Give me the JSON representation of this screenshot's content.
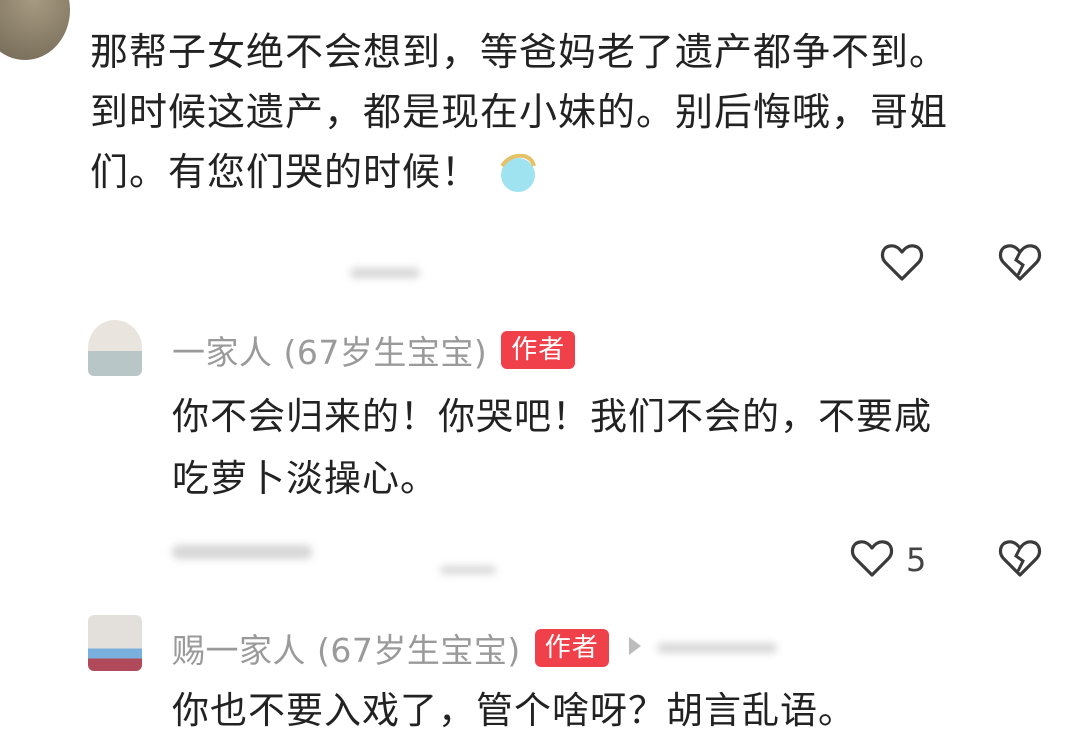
{
  "comment_top": {
    "text_lines": [
      "那帮子女绝不会想到，等爸妈老了遗产都争不到。",
      "到时候这遗产，都是现在小妹的。别后悔哦，哥姐",
      "们。有您们哭的时候！"
    ]
  },
  "reply_1": {
    "author": "一家人 (67岁生宝宝)",
    "badge": "作者",
    "text_lines": [
      "你不会归来的！你哭吧！我们不会的，不要咸",
      "吃萝卜淡操心。"
    ],
    "like_count": "5"
  },
  "reply_2": {
    "author": "赐一家人 (67岁生宝宝)",
    "badge": "作者",
    "text": "你也不要入戏了，管个啥呀？胡言乱语。"
  },
  "icons": [
    "heart-outline-icon",
    "heart-broken-icon",
    "emoji-icon",
    "reply-arrow-icon"
  ]
}
